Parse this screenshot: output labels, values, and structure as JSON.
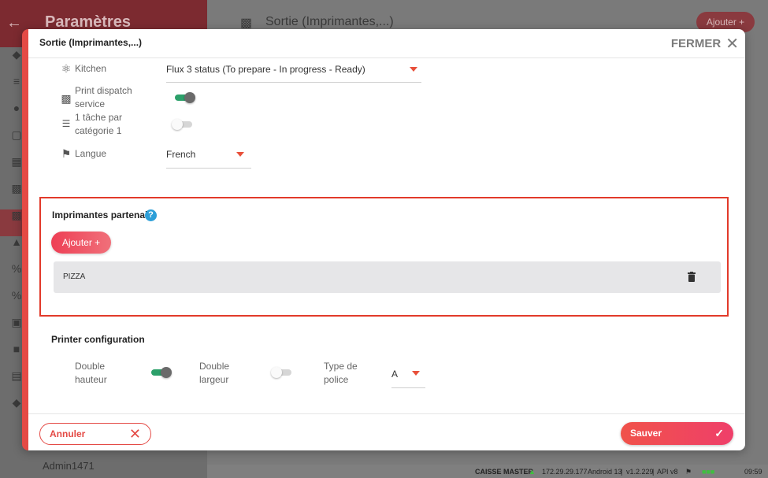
{
  "background": {
    "sidebar_title": "Paramètres",
    "back_icon": "arrow-left-icon",
    "header_title": "Sortie (Imprimantes,...)",
    "add_button": "Ajouter +",
    "user": "Admin1471",
    "status": {
      "device": "CAISSE MASTER",
      "ip": "172.29.29.177",
      "android": "Android 13",
      "version": "v1.2.229",
      "api": "API v8",
      "time": "09:59"
    }
  },
  "modal": {
    "title": "Sortie (Imprimantes,...)",
    "close_label": "FERMER",
    "fields": {
      "kitchen": {
        "label": "Kitchen",
        "value": "Flux 3 status (To prepare - In progress - Ready)",
        "icon": "utensils-icon"
      },
      "print_dispatch": {
        "label": "Print dispatch service",
        "enabled": true,
        "icon": "printer-icon"
      },
      "one_task": {
        "label": "1 tâche par catégorie 1",
        "enabled": false,
        "icon": "checklist-icon"
      },
      "language": {
        "label": "Langue",
        "value": "French",
        "icon": "flag-icon"
      }
    },
    "partners": {
      "title": "Imprimantes partenaire",
      "help_symbol": "?",
      "add_label": "Ajouter +",
      "items": [
        {
          "name": "PIZZA"
        }
      ]
    },
    "printer_config": {
      "title": "Printer configuration",
      "double_height": {
        "label": "Double hauteur",
        "enabled": true
      },
      "double_width": {
        "label": "Double largeur",
        "enabled": false
      },
      "font_type": {
        "label": "Type de police",
        "value": "A"
      }
    },
    "cancel_label": "Annuler",
    "save_label": "Sauver"
  },
  "colors": {
    "accent": "#e44a45",
    "toggle_on": "#2ca06a",
    "help": "#2d9fd8"
  }
}
